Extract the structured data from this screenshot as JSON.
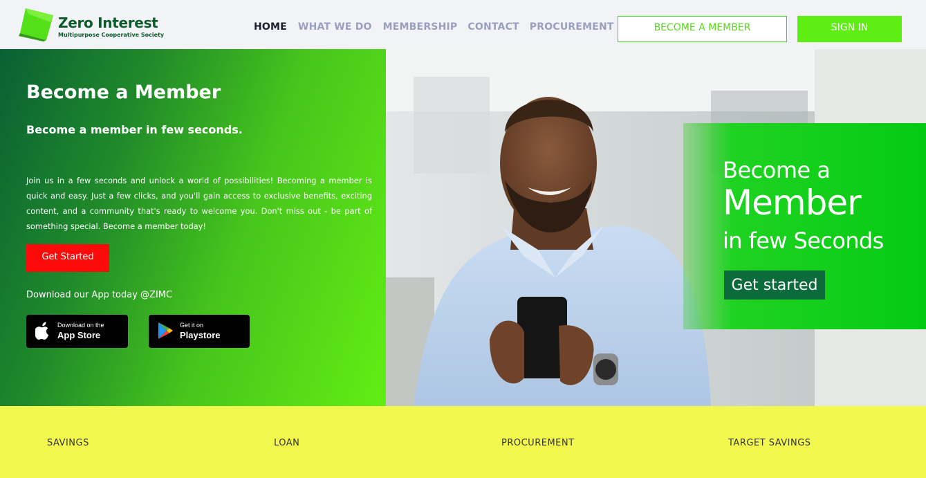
{
  "brand": {
    "title": "Zero Interest",
    "subtitle": "Multipurpose Cooperative Society",
    "colors": {
      "primary": "#0c5b2b",
      "accent": "#5fee14",
      "cta": "#ff0a0a",
      "band": "#f2f84e"
    }
  },
  "nav": {
    "items": [
      "HOME",
      "WHAT WE DO",
      "MEMBERSHIP",
      "CONTACT",
      "PROCUREMENT"
    ],
    "active": "HOME",
    "become_member": "BECOME A MEMBER",
    "sign_in": "SIGN IN"
  },
  "hero": {
    "title": "Become a Member",
    "subtitle": "Become a member in few seconds.",
    "body": "Join us in a few seconds and unlock a world of possibilities! Becoming a member is quick and easy. Just a few clicks, and you'll gain access to exclusive benefits, exciting content, and a community that's ready to welcome you. Don't miss out - be part of something special. Become a member today!",
    "cta": "Get Started",
    "download_label": "Download our App today @ZIMC",
    "app_store": {
      "small": "Download on the",
      "big": "App Store",
      "icon": "apple-icon"
    },
    "play_store": {
      "small": "Get it on",
      "big": "Playstore",
      "icon": "google-play-icon"
    }
  },
  "promo": {
    "line1": "Become a",
    "line2": "Member",
    "line3": "in few Seconds",
    "button": "Get started"
  },
  "services": [
    "SAVINGS",
    "LOAN",
    "PROCUREMENT",
    "TARGET SAVINGS"
  ]
}
